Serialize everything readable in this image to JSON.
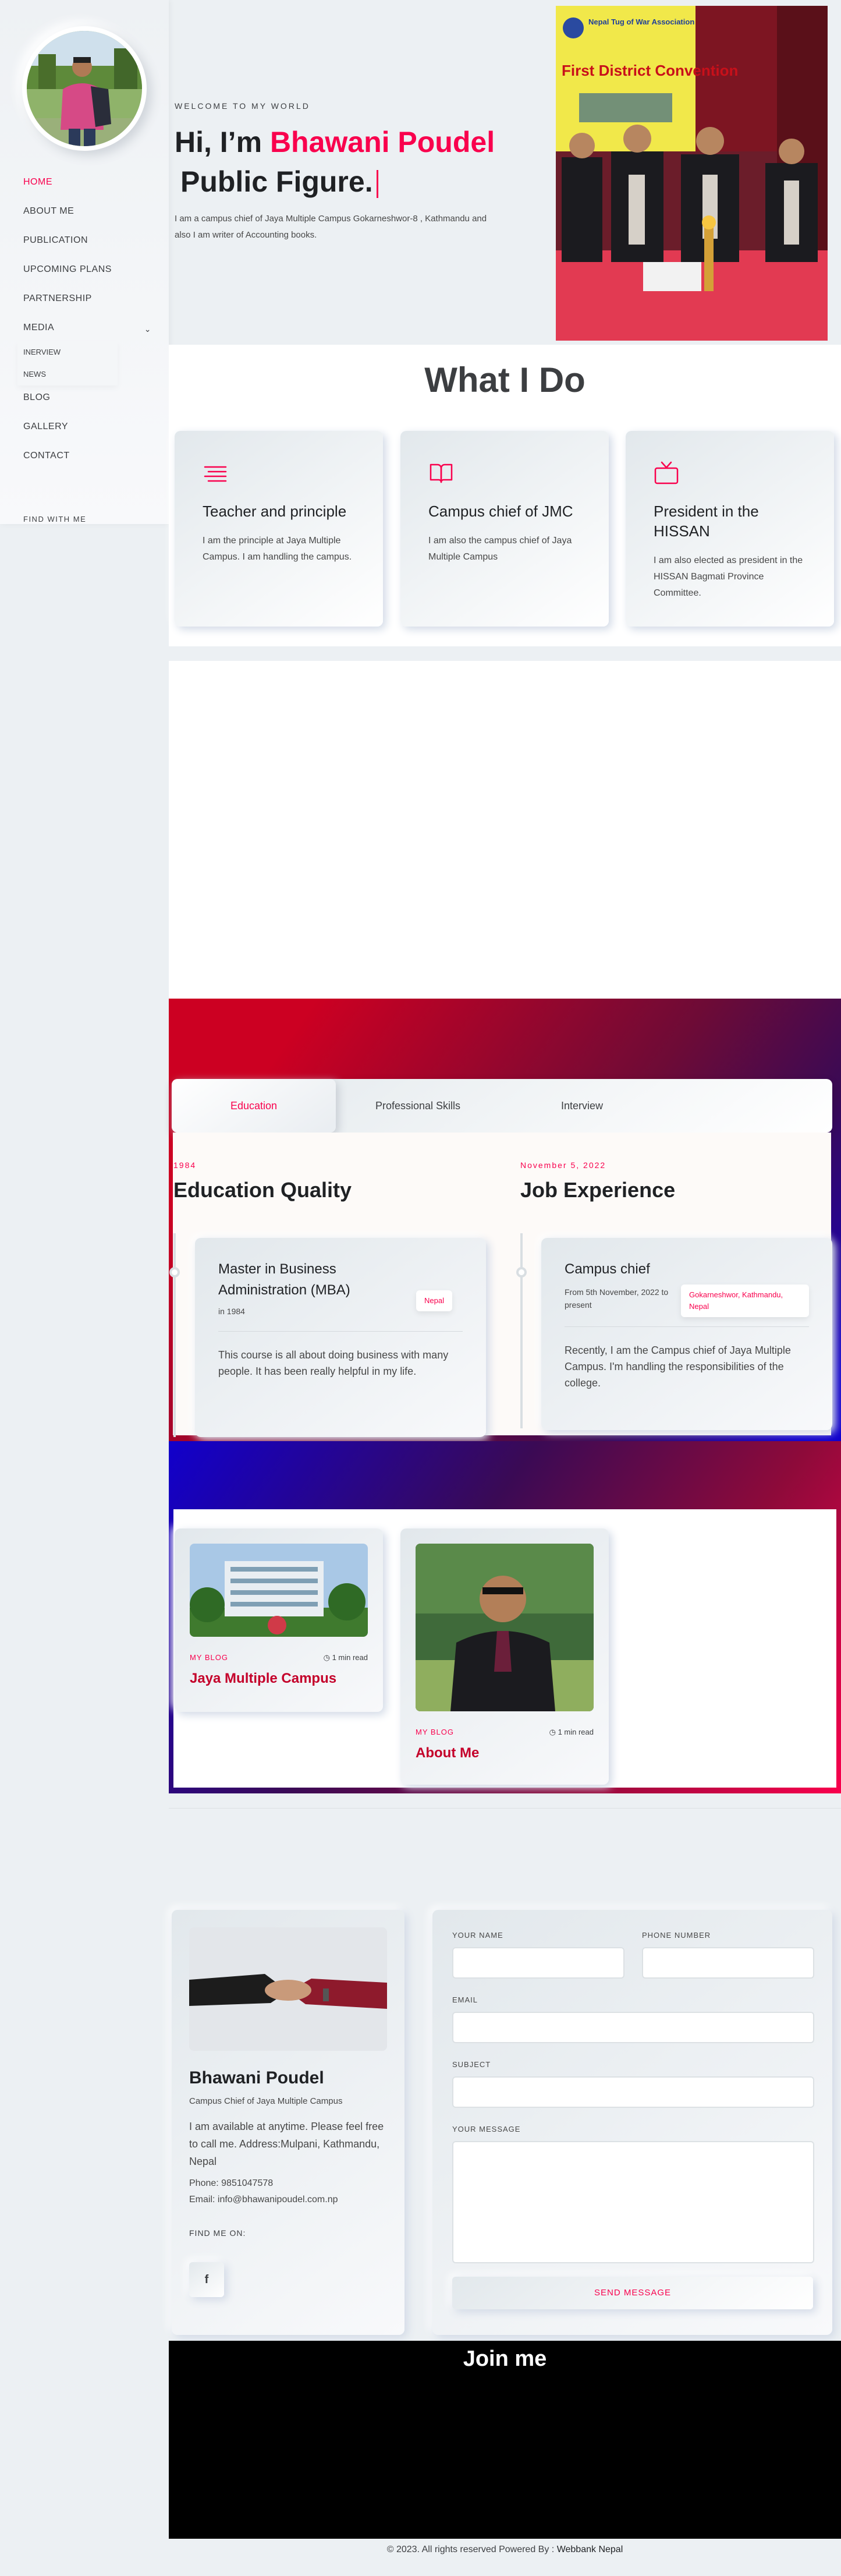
{
  "sidebar": {
    "nav": [
      "HOME",
      "ABOUT ME",
      "PUBLICATION",
      "UPCOMING PLANS",
      "PARTNERSHIP",
      "MEDIA"
    ],
    "submenu": [
      "INERVIEW",
      "NEWS"
    ],
    "nav2": [
      "BLOG",
      "GALLERY",
      "CONTACT"
    ],
    "find_with_me": "FIND WITH ME"
  },
  "hero": {
    "welcome": "WELCOME TO MY WORLD",
    "greeting": "Hi, I’m",
    "name": "Bhawani Poudel",
    "title": "Public Figure.",
    "desc": "I am a campus chief of Jaya Multiple Campus Gokarneshwor-8 , Kathmandu and also I am writer of Accounting books.",
    "photo_banner": "Nepal Tug of War Association",
    "photo_banner2": "First District Convention"
  },
  "services": {
    "title": "What I Do",
    "cards": [
      {
        "icon": "list-icon",
        "title": "Teacher and principle",
        "desc": "I am the principle at Jaya Multiple Campus. I am handling the campus."
      },
      {
        "icon": "book-icon",
        "title": "Campus chief of JMC",
        "desc": "I am also the campus chief of Jaya Multiple Campus"
      },
      {
        "icon": "tv-icon",
        "title": "President in the HISSAN",
        "desc": "I am also elected as president in the HISSAN Bagmati Province Committee."
      }
    ]
  },
  "resume": {
    "tabs": [
      "Education",
      "Professional Skills",
      "Interview"
    ],
    "education": {
      "date": "1984",
      "heading": "Education Quality",
      "card_title": "Master in Business Administration (MBA)",
      "card_sub": "in 1984",
      "tag": "Nepal",
      "card_desc": "This course is all about doing business with many people. It has been really helpful in my life."
    },
    "job": {
      "date": "November 5, 2022",
      "heading": "Job Experience",
      "card_title": "Campus chief",
      "card_sub": "From 5th November, 2022 to present",
      "tag": "Gokarneshwor, Kathmandu, Nepal",
      "card_desc": "Recently, I am the Campus chief of Jaya Multiple Campus. I'm handling the responsibilities of the college."
    }
  },
  "blog": {
    "posts": [
      {
        "category": "MY BLOG",
        "read": "1 min read",
        "title": "Jaya Multiple Campus"
      },
      {
        "category": "MY BLOG",
        "read": "1 min read",
        "title": "About Me"
      }
    ]
  },
  "contact": {
    "name": "Bhawani Poudel",
    "role": "Campus Chief of Jaya Multiple Campus",
    "desc": "I am available at anytime. Please feel free to call me. Address:Mulpani, Kathmandu, Nepal",
    "phone": "Phone: 9851047578",
    "email": "Email: info@bhawanipoudel.com.np",
    "find_me": "FIND ME ON:",
    "social": "f",
    "form": {
      "name_label": "YOUR NAME",
      "phone_label": "PHONE NUMBER",
      "email_label": "EMAIL",
      "subject_label": "SUBJECT",
      "message_label": "YOUR MESSAGE",
      "send": "SEND MESSAGE"
    }
  },
  "joinme": {
    "title": "Join me"
  },
  "footer": {
    "text": "© 2023. All rights reserved Powered By :",
    "link": "Webbank Nepal"
  },
  "colors": {
    "accent": "#f9004d",
    "bg": "#ecf0f3",
    "text": "#3c3e41"
  }
}
